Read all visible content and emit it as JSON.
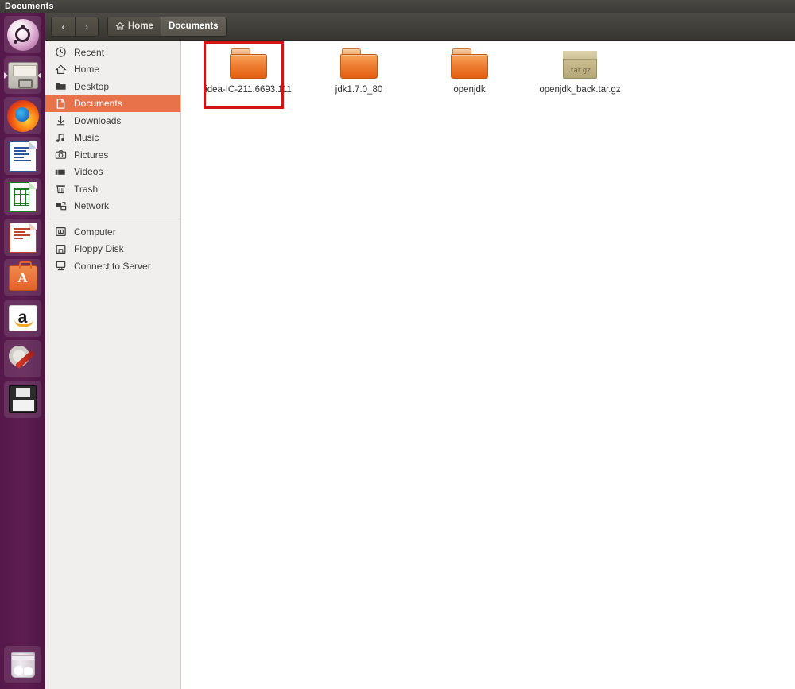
{
  "top_panel": {
    "title": "Documents"
  },
  "launcher": {
    "items": [
      {
        "name": "ubuntu-dash",
        "label": "Ubuntu Dash",
        "icon": "ubuntu-icon"
      },
      {
        "name": "files",
        "label": "Files",
        "icon": "file-manager-icon",
        "running": true
      },
      {
        "name": "firefox",
        "label": "Firefox Web Browser",
        "icon": "firefox-icon"
      },
      {
        "name": "writer",
        "label": "LibreOffice Writer",
        "icon": "document-icon"
      },
      {
        "name": "calc",
        "label": "LibreOffice Calc",
        "icon": "spreadsheet-icon"
      },
      {
        "name": "impress",
        "label": "LibreOffice Impress",
        "icon": "presentation-icon"
      },
      {
        "name": "software",
        "label": "Ubuntu Software Center",
        "icon": "software-center-icon"
      },
      {
        "name": "amazon",
        "label": "Amazon",
        "icon": "amazon-icon"
      },
      {
        "name": "settings",
        "label": "System Settings",
        "icon": "gear-wrench-icon"
      },
      {
        "name": "floppy",
        "label": "Save",
        "icon": "floppy-disk-icon"
      },
      {
        "name": "trash",
        "label": "Trash",
        "icon": "trash-icon"
      }
    ]
  },
  "toolbar": {
    "back_label": "‹",
    "forward_label": "›",
    "breadcrumb": [
      {
        "label": "Home",
        "icon": "home-icon",
        "active": false
      },
      {
        "label": "Documents",
        "icon": "",
        "active": true
      }
    ]
  },
  "sidebar": {
    "items": [
      {
        "label": "Recent",
        "icon": "clock-icon",
        "selected": false
      },
      {
        "label": "Home",
        "icon": "home-icon",
        "selected": false
      },
      {
        "label": "Desktop",
        "icon": "desktop-folder-icon",
        "selected": false
      },
      {
        "label": "Documents",
        "icon": "document-icon",
        "selected": true
      },
      {
        "label": "Downloads",
        "icon": "download-arrow-icon",
        "selected": false
      },
      {
        "label": "Music",
        "icon": "music-note-icon",
        "selected": false
      },
      {
        "label": "Pictures",
        "icon": "camera-icon",
        "selected": false
      },
      {
        "label": "Videos",
        "icon": "video-camera-icon",
        "selected": false
      },
      {
        "label": "Trash",
        "icon": "trash-icon",
        "selected": false
      },
      {
        "label": "Network",
        "icon": "network-icon",
        "selected": false
      }
    ],
    "items_group2": [
      {
        "label": "Computer",
        "icon": "computer-icon",
        "selected": false
      },
      {
        "label": "Floppy Disk",
        "icon": "floppy-disk-icon",
        "selected": false
      },
      {
        "label": "Connect to Server",
        "icon": "connect-server-icon",
        "selected": false
      }
    ]
  },
  "content": {
    "files": [
      {
        "name": "idea-IC-211.6693.111",
        "type": "folder",
        "selected": true
      },
      {
        "name": "jdk1.7.0_80",
        "type": "folder",
        "selected": false
      },
      {
        "name": "openjdk",
        "type": "folder",
        "selected": false
      },
      {
        "name": "openjdk_back.tar.gz",
        "type": "archive",
        "archive_tag": ".tar.gz",
        "selected": false
      }
    ]
  },
  "colors": {
    "launcher_purple": "#5d1d51",
    "header_dark": "#413f3a",
    "sidebar_bg": "#f0efed",
    "selection_orange": "#e8734a",
    "folder_orange": "#ee7f33",
    "annotation_red": "#d41414"
  }
}
